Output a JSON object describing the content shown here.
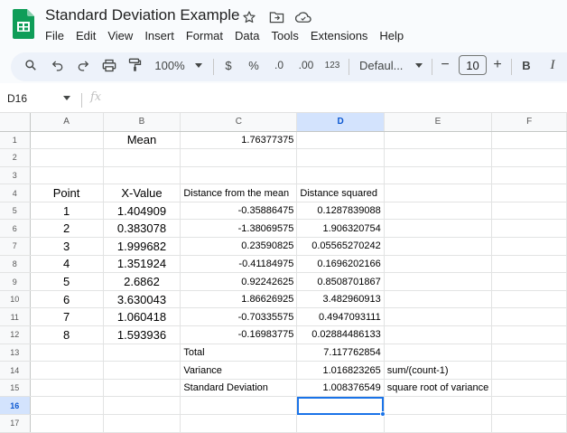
{
  "app": {
    "doc_title": "Standard Deviation Example",
    "brand_color": "#0f9d58",
    "title_icons": [
      "star-icon",
      "move-to-folder-icon",
      "cloud-status-icon"
    ],
    "menu": [
      "File",
      "Edit",
      "View",
      "Insert",
      "Format",
      "Data",
      "Tools",
      "Extensions",
      "Help"
    ]
  },
  "toolbar": {
    "zoom": "100%",
    "currency": "$",
    "percent": "%",
    "decrease_decimal": ".0",
    "increase_decimal": ".00",
    "more_formats": "123",
    "font": "Defaul...",
    "font_size": "10",
    "minus": "−",
    "plus": "+",
    "bold": "B",
    "italic": "I"
  },
  "formula_bar": {
    "cell_ref": "D16",
    "fx": "fx",
    "value": ""
  },
  "sheet": {
    "columns": [
      "A",
      "B",
      "C",
      "D",
      "E",
      "F"
    ],
    "selected_column": "D",
    "selected_row": 16,
    "accent_color": "#1a73e8",
    "rows": [
      {
        "n": "1",
        "a": "",
        "b": "Mean",
        "c": "1.76377375",
        "d": "",
        "e": ""
      },
      {
        "n": "2",
        "a": "",
        "b": "",
        "c": "",
        "d": "",
        "e": ""
      },
      {
        "n": "3",
        "a": "",
        "b": "",
        "c": "",
        "d": "",
        "e": ""
      },
      {
        "n": "4",
        "a": "Point",
        "b": "X-Value",
        "c": "Distance from the mean",
        "d": "Distance squared",
        "e": ""
      },
      {
        "n": "5",
        "a": "1",
        "b": "1.404909",
        "c": "-0.35886475",
        "d": "0.1287839088",
        "e": ""
      },
      {
        "n": "6",
        "a": "2",
        "b": "0.383078",
        "c": "-1.38069575",
        "d": "1.906320754",
        "e": ""
      },
      {
        "n": "7",
        "a": "3",
        "b": "1.999682",
        "c": "0.23590825",
        "d": "0.05565270242",
        "e": ""
      },
      {
        "n": "8",
        "a": "4",
        "b": "1.351924",
        "c": "-0.41184975",
        "d": "0.1696202166",
        "e": ""
      },
      {
        "n": "9",
        "a": "5",
        "b": "2.6862",
        "c": "0.92242625",
        "d": "0.8508701867",
        "e": ""
      },
      {
        "n": "10",
        "a": "6",
        "b": "3.630043",
        "c": "1.86626925",
        "d": "3.482960913",
        "e": ""
      },
      {
        "n": "11",
        "a": "7",
        "b": "1.060418",
        "c": "-0.70335575",
        "d": "0.4947093111",
        "e": ""
      },
      {
        "n": "12",
        "a": "8",
        "b": "1.593936",
        "c": "-0.16983775",
        "d": "0.02884486133",
        "e": ""
      },
      {
        "n": "13",
        "a": "",
        "b": "",
        "c": "Total",
        "d": "7.117762854",
        "e": ""
      },
      {
        "n": "14",
        "a": "",
        "b": "",
        "c": "Variance",
        "d": "1.016823265",
        "e": "sum/(count-1)"
      },
      {
        "n": "15",
        "a": "",
        "b": "",
        "c": "Standard Deviation",
        "d": "1.008376549",
        "e": "square root of variance"
      },
      {
        "n": "16",
        "a": "",
        "b": "",
        "c": "",
        "d": "",
        "e": ""
      },
      {
        "n": "17",
        "a": "",
        "b": "",
        "c": "",
        "d": "",
        "e": ""
      }
    ]
  }
}
